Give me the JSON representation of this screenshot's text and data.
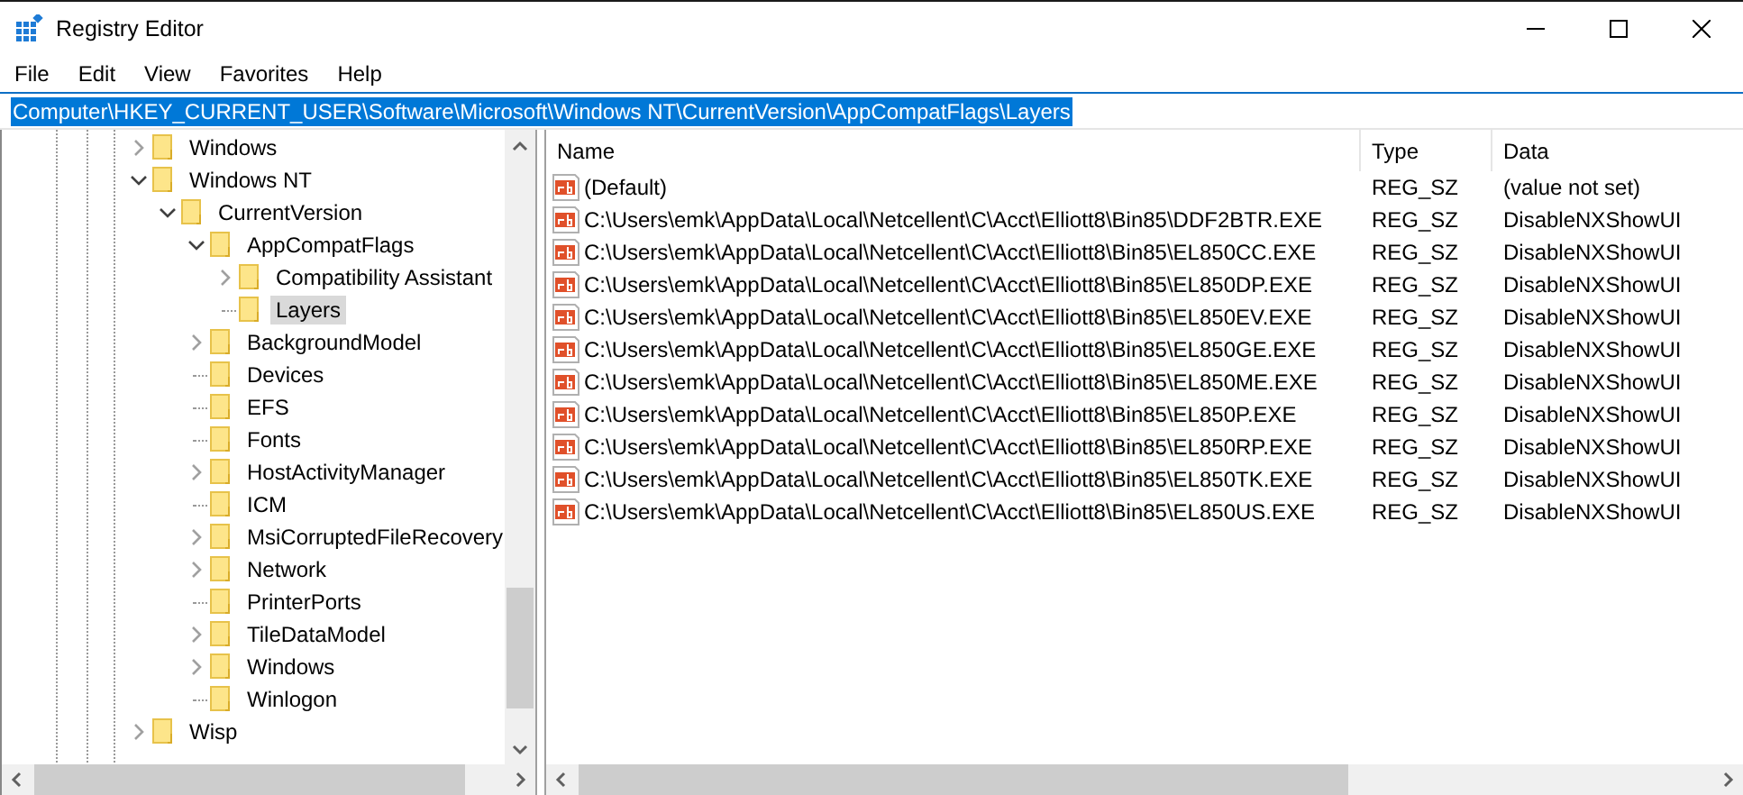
{
  "window": {
    "title": "Registry Editor"
  },
  "menu": [
    {
      "label": "File"
    },
    {
      "label": "Edit"
    },
    {
      "label": "View"
    },
    {
      "label": "Favorites"
    },
    {
      "label": "Help"
    }
  ],
  "address": {
    "value": "Computer\\HKEY_CURRENT_USER\\Software\\Microsoft\\Windows NT\\CurrentVersion\\AppCompatFlags\\Layers",
    "selected": true
  },
  "tree": [
    {
      "label": "Windows",
      "kind": "closed",
      "selected": false
    },
    {
      "label": "Windows NT",
      "kind": "open",
      "selected": false,
      "children": [
        {
          "label": "CurrentVersion",
          "kind": "open",
          "selected": false,
          "children": [
            {
              "label": "AppCompatFlags",
              "kind": "open",
              "selected": false,
              "children": [
                {
                  "label": "Compatibility Assistant",
                  "kind": "closed",
                  "selected": false
                },
                {
                  "label": "Layers",
                  "kind": "leaf",
                  "selected": true
                }
              ]
            },
            {
              "label": "BackgroundModel",
              "kind": "closed",
              "selected": false
            },
            {
              "label": "Devices",
              "kind": "leaf",
              "selected": false
            },
            {
              "label": "EFS",
              "kind": "leaf",
              "selected": false
            },
            {
              "label": "Fonts",
              "kind": "leaf",
              "selected": false
            },
            {
              "label": "HostActivityManager",
              "kind": "closed",
              "selected": false
            },
            {
              "label": "ICM",
              "kind": "leaf",
              "selected": false
            },
            {
              "label": "MsiCorruptedFileRecovery",
              "kind": "closed",
              "selected": false
            },
            {
              "label": "Network",
              "kind": "closed",
              "selected": false
            },
            {
              "label": "PrinterPorts",
              "kind": "leaf",
              "selected": false
            },
            {
              "label": "TileDataModel",
              "kind": "closed",
              "selected": false
            },
            {
              "label": "Windows",
              "kind": "closed",
              "selected": false
            },
            {
              "label": "Winlogon",
              "kind": "leaf",
              "selected": false
            }
          ]
        }
      ]
    },
    {
      "label": "Wisp",
      "kind": "closed",
      "selected": false
    }
  ],
  "table": {
    "columns": [
      "Name",
      "Type",
      "Data"
    ],
    "rows": [
      {
        "name": "(Default)",
        "type": "REG_SZ",
        "data": "(value not set)"
      },
      {
        "name": "C:\\Users\\emk\\AppData\\Local\\Netcellent\\C\\Acct\\Elliott8\\Bin85\\DDF2BTR.EXE",
        "type": "REG_SZ",
        "data": "DisableNXShowUI"
      },
      {
        "name": "C:\\Users\\emk\\AppData\\Local\\Netcellent\\C\\Acct\\Elliott8\\Bin85\\EL850CC.EXE",
        "type": "REG_SZ",
        "data": "DisableNXShowUI"
      },
      {
        "name": "C:\\Users\\emk\\AppData\\Local\\Netcellent\\C\\Acct\\Elliott8\\Bin85\\EL850DP.EXE",
        "type": "REG_SZ",
        "data": "DisableNXShowUI"
      },
      {
        "name": "C:\\Users\\emk\\AppData\\Local\\Netcellent\\C\\Acct\\Elliott8\\Bin85\\EL850EV.EXE",
        "type": "REG_SZ",
        "data": "DisableNXShowUI"
      },
      {
        "name": "C:\\Users\\emk\\AppData\\Local\\Netcellent\\C\\Acct\\Elliott8\\Bin85\\EL850GE.EXE",
        "type": "REG_SZ",
        "data": "DisableNXShowUI"
      },
      {
        "name": "C:\\Users\\emk\\AppData\\Local\\Netcellent\\C\\Acct\\Elliott8\\Bin85\\EL850ME.EXE",
        "type": "REG_SZ",
        "data": "DisableNXShowUI"
      },
      {
        "name": "C:\\Users\\emk\\AppData\\Local\\Netcellent\\C\\Acct\\Elliott8\\Bin85\\EL850P.EXE",
        "type": "REG_SZ",
        "data": "DisableNXShowUI"
      },
      {
        "name": "C:\\Users\\emk\\AppData\\Local\\Netcellent\\C\\Acct\\Elliott8\\Bin85\\EL850RP.EXE",
        "type": "REG_SZ",
        "data": "DisableNXShowUI"
      },
      {
        "name": "C:\\Users\\emk\\AppData\\Local\\Netcellent\\C\\Acct\\Elliott8\\Bin85\\EL850TK.EXE",
        "type": "REG_SZ",
        "data": "DisableNXShowUI"
      },
      {
        "name": "C:\\Users\\emk\\AppData\\Local\\Netcellent\\C\\Acct\\Elliott8\\Bin85\\EL850US.EXE",
        "type": "REG_SZ",
        "data": "DisableNXShowUI"
      }
    ]
  }
}
